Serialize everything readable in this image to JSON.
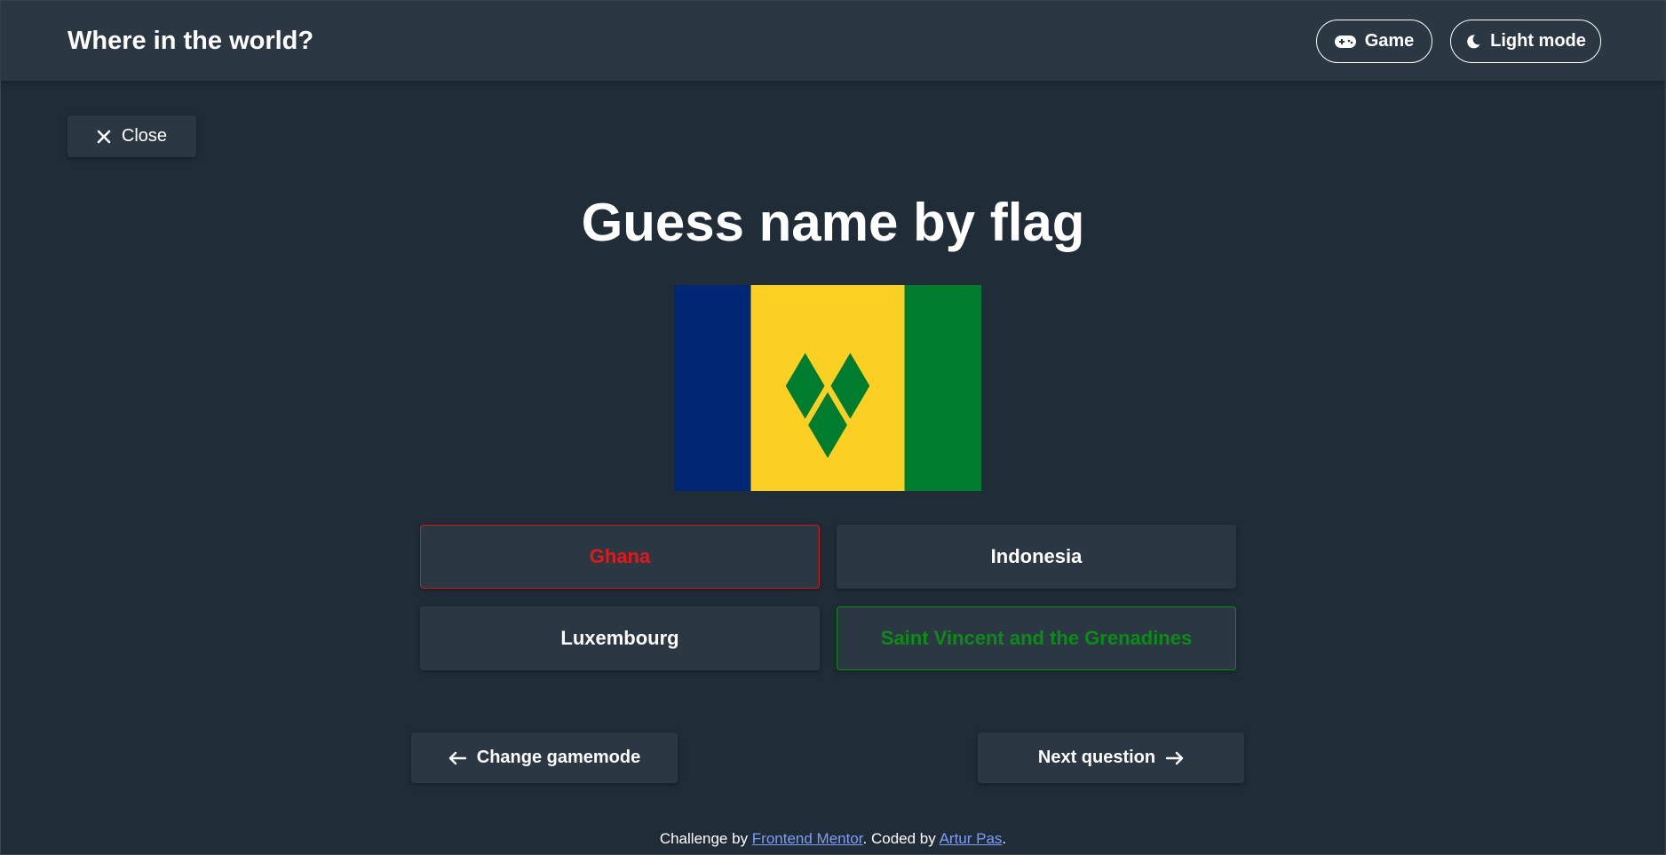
{
  "header": {
    "title": "Where in the world?",
    "game_label": "Game",
    "theme_label": "Light mode"
  },
  "close_label": "Close",
  "game": {
    "heading": "Guess name by flag",
    "answers": [
      {
        "label": "Ghana",
        "state": "wrong"
      },
      {
        "label": "Indonesia",
        "state": "neutral"
      },
      {
        "label": "Luxembourg",
        "state": "neutral"
      },
      {
        "label": "Saint Vincent and the Grenadines",
        "state": "correct"
      }
    ],
    "prev_label": "Change gamemode",
    "next_label": "Next question"
  },
  "footer": {
    "prefix": "Challenge by ",
    "link1": "Frontend Mentor",
    "middle": ". Coded by ",
    "link2": "Artur Pas",
    "suffix": "."
  },
  "colors": {
    "background": "#202c37",
    "surface": "#2b3844",
    "wrong": "#e01a1a",
    "correct": "#0e8a18",
    "link": "#7f9cf5",
    "flag_blue": "#002674",
    "flag_yellow": "#fcd022",
    "flag_green": "#007c2e"
  },
  "icons": {
    "game": "gamepad-icon",
    "theme": "moon-icon",
    "close": "close-icon",
    "prev": "arrow-left-icon",
    "next": "arrow-right-icon"
  }
}
